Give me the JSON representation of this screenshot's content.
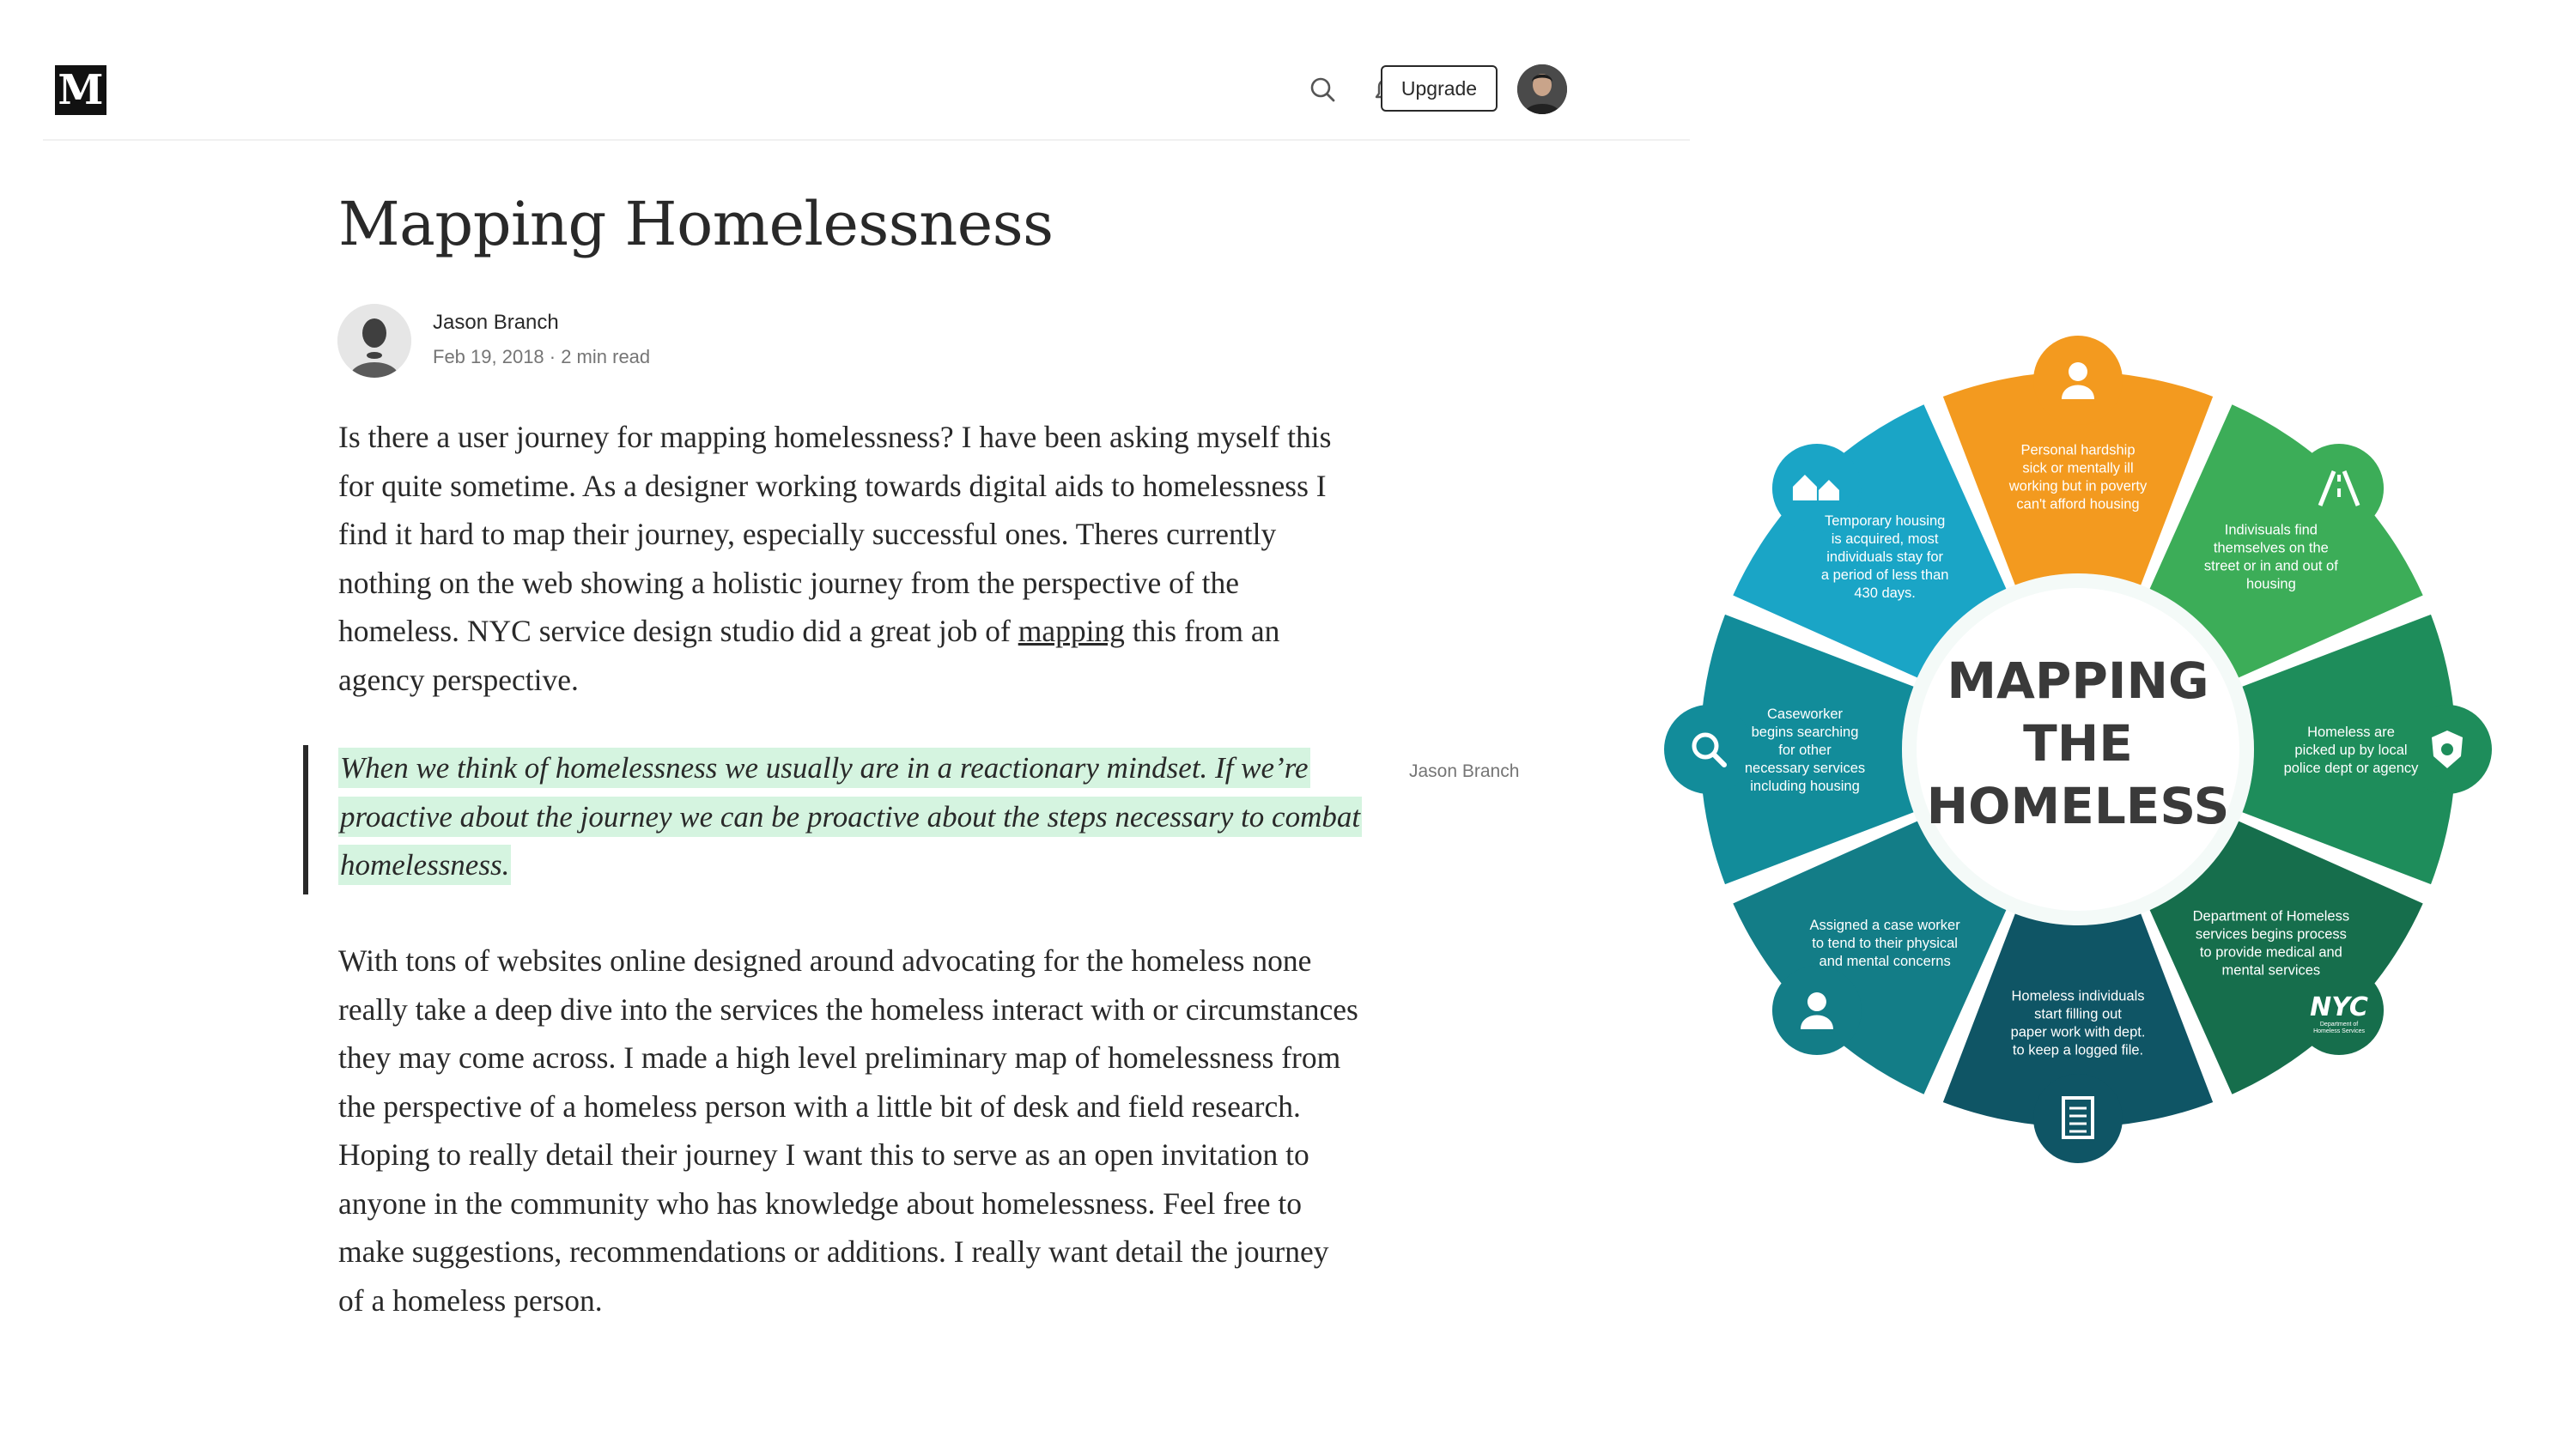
{
  "header": {
    "logo_letter": "M",
    "upgrade_label": "Upgrade",
    "icons": [
      "search-icon",
      "bell-icon"
    ]
  },
  "article": {
    "title": "Mapping Homelessness",
    "author": "Jason Branch",
    "meta": "Feb 19, 2018 · 2 min read",
    "p1_text": "Is there a user journey for mapping homelessness? I have been asking myself this for quite sometime. As a designer working towards digital aids to homelessness I find it hard to map their journey, especially successful ones. Theres currently nothing on the web showing a holistic journey from the perspective of the homeless. NYC service design studio did a great job of ",
    "p1_link": "mapping",
    "p1_tail": " this from an agency perspective.",
    "quote": "When we think of homelessness we usually are in a reactionary mindset. If we’re proactive about the journey we can be proactive about the steps necessary to combat homelessness.",
    "quote_attribution": "Jason Branch",
    "p2_text": "With tons of websites online designed around advocating for the homeless none really take a deep dive into the services the homeless interact with or circumstances they may come across. I made a high level preliminary map of homelessness from the perspective of a homeless person with a little bit of desk and field research. Hoping to really detail their journey I want this to serve as an open invitation to anyone in the community who has knowledge about homelessness. Feel free to make suggestions, recommendations or additions. I really want detail the journey of a homeless person."
  },
  "infographic": {
    "center_title_lines": [
      "MAPPING",
      "THE",
      "HOMELESS"
    ],
    "segments": [
      {
        "lines": [
          "Personal hardship",
          "sick or mentally ill",
          "working but in poverty",
          "can't afford housing"
        ],
        "color": "#f39a1f",
        "icon": "person-icon"
      },
      {
        "lines": [
          "Indivisuals find",
          "themselves on the",
          "street or in and out of",
          "housing"
        ],
        "color": "#3cad58",
        "icon": "road-icon"
      },
      {
        "lines": [
          "Homeless are",
          "picked up by local",
          "police dept or agency"
        ],
        "color": "#1e8d5b",
        "icon": "police-badge-icon"
      },
      {
        "lines": [
          "Department of Homeless",
          "services begins process",
          "to provide medical and",
          "mental services"
        ],
        "color": "#166e4c",
        "icon": "nyc-logo"
      },
      {
        "lines": [
          "Homeless individuals",
          "start filling out",
          "paper work with dept.",
          "to keep a logged file."
        ],
        "color": "#0f5565",
        "icon": "document-icon"
      },
      {
        "lines": [
          "Assigned a  case worker",
          "to tend to their physical",
          "and mental concerns"
        ],
        "color": "#137d87",
        "icon": "person-icon"
      },
      {
        "lines": [
          "Caseworker",
          "begins searching",
          "for other",
          "necessary services",
          "including housing"
        ],
        "color": "#128c9a",
        "icon": "search-icon"
      },
      {
        "lines": [
          "Temporary housing",
          "is acquired, most",
          "individuals stay for",
          "a period of less than",
          "430 days."
        ],
        "color": "#1aa5c6",
        "icon": "houses-icon"
      }
    ],
    "nyc_logo_text": "NYC",
    "nyc_logo_sub": [
      "Department of",
      "Homeless Services"
    ]
  }
}
